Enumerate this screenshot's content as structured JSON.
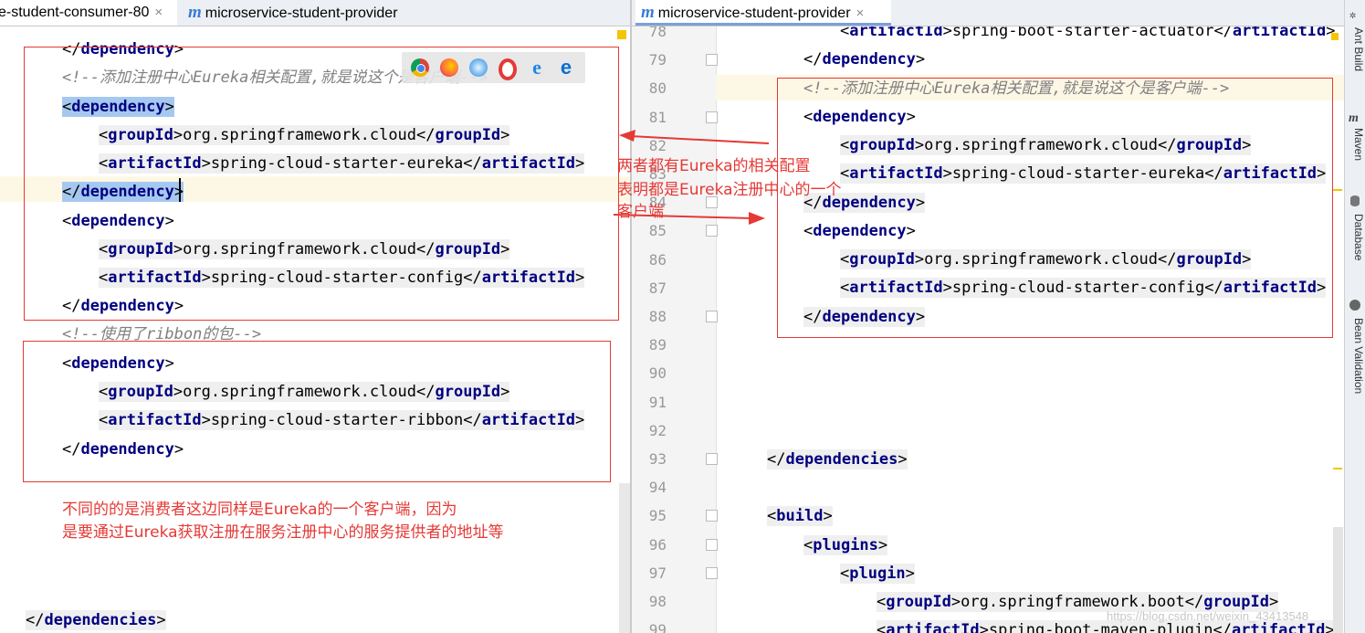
{
  "tabs": {
    "left_consumer": "e-student-consumer-80",
    "left_provider": "microservice-student-provider",
    "right_provider": "microservice-student-provider",
    "close": "×",
    "m_icon": "m"
  },
  "left": {
    "lines": [
      {
        "comment": "<!--添加注册中心Eureka相关配置,就是说这个是客户端-->"
      },
      {
        "open": "dependency"
      },
      {
        "tag": "groupId",
        "value": "org.springframework.cloud"
      },
      {
        "tag": "artifactId",
        "value": "spring-cloud-starter-eureka"
      },
      {
        "close": "dependency"
      },
      {
        "open": "dependency"
      },
      {
        "tag": "groupId",
        "value": "org.springframework.cloud"
      },
      {
        "tag": "artifactId",
        "value": "spring-cloud-starter-config"
      },
      {
        "close": "dependency"
      },
      {
        "comment": "<!--使用了ribbon的包-->"
      },
      {
        "open": "dependency"
      },
      {
        "tag": "groupId",
        "value": "org.springframework.cloud"
      },
      {
        "tag": "artifactId",
        "value": "spring-cloud-starter-ribbon"
      },
      {
        "close": "dependency"
      },
      {
        "close_root": "dependencies"
      }
    ],
    "top_partial": "dependency"
  },
  "right": {
    "line_numbers": [
      "78",
      "79",
      "80",
      "81",
      "82",
      "83",
      "84",
      "85",
      "86",
      "87",
      "88",
      "89",
      "90",
      "91",
      "92",
      "93",
      "94",
      "95",
      "96",
      "97",
      "98",
      "99"
    ],
    "lines": {
      "l78": {
        "tag": "artifactId",
        "value": "spring-boot-starter-actuator"
      },
      "l79": {
        "close": "dependency"
      },
      "l80": {
        "comment": "<!--添加注册中心Eureka相关配置,就是说这个是客户端-->"
      },
      "l81": {
        "open": "dependency"
      },
      "l82": {
        "tag": "groupId",
        "value": "org.springframework.cloud"
      },
      "l83": {
        "tag": "artifactId",
        "value": "spring-cloud-starter-eureka"
      },
      "l84": {
        "close": "dependency"
      },
      "l85": {
        "open": "dependency"
      },
      "l86": {
        "tag": "groupId",
        "value": "org.springframework.cloud"
      },
      "l87": {
        "tag": "artifactId",
        "value": "spring-cloud-starter-config"
      },
      "l88": {
        "close": "dependency"
      },
      "l93": {
        "close": "dependencies"
      },
      "l95": {
        "open": "build"
      },
      "l96": {
        "open": "plugins"
      },
      "l97": {
        "open": "plugin"
      },
      "l98": {
        "tag": "groupId",
        "value": "org.springframework.boot"
      },
      "l99": {
        "tag": "artifactId",
        "value": "spring-boot-maven-plugin"
      }
    }
  },
  "annotations": {
    "middle_line1": "两者都有Eureka的相关配置",
    "middle_line2": "表明都是Eureka注册中心的一个",
    "middle_line3": "客户端",
    "bottom_line1": "不同的的是消费者这边同样是Eureka的一个客户端，因为",
    "bottom_line2": "是要通过Eureka获取注册在服务注册中心的服务提供者的地址等"
  },
  "tool_windows": [
    "Ant Build",
    "Maven",
    "Database",
    "Bean Validation"
  ],
  "watermark": "https://blog.csdn.net/weixin_43413548",
  "colors": {
    "annotation_red": "#e53935",
    "tag_blue": "#000080",
    "comment_gray": "#808080"
  }
}
